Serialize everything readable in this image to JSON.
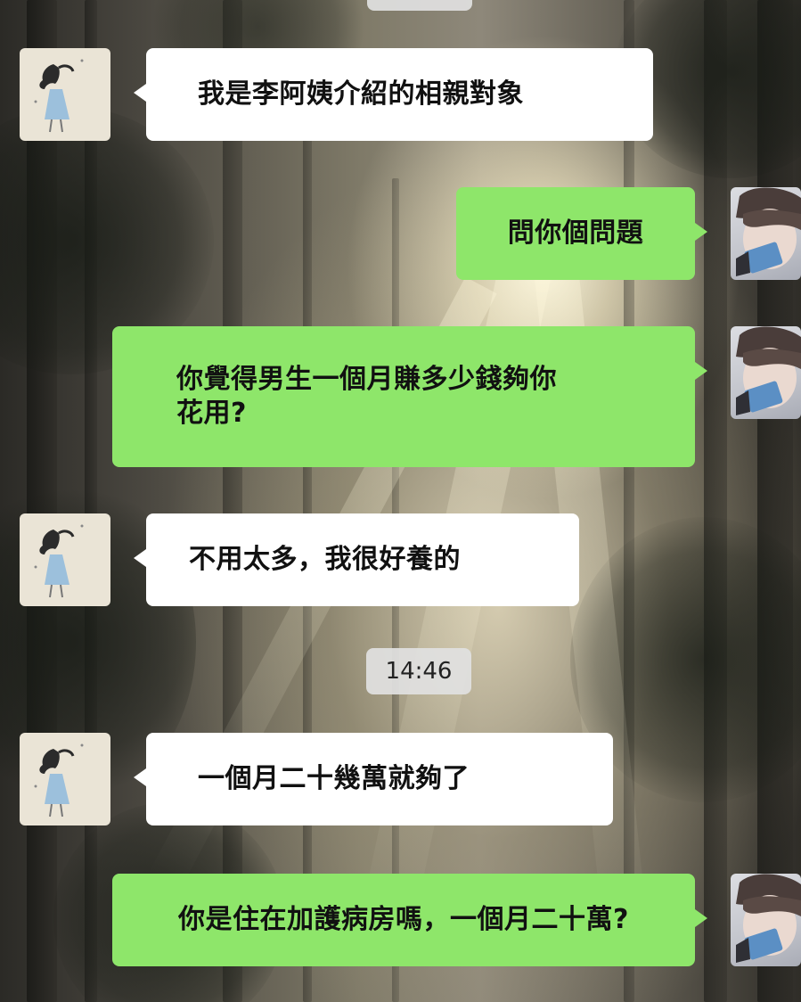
{
  "chat": {
    "messages": [
      {
        "side": "left",
        "sender": "girl",
        "text": "我是李阿姨介紹的相親對象"
      },
      {
        "side": "right",
        "sender": "boy",
        "text": "問你個問題"
      },
      {
        "side": "right",
        "sender": "boy",
        "line1": "你覺得男生一個月賺多少錢夠你",
        "line2": "花用?"
      },
      {
        "side": "left",
        "sender": "girl",
        "text": "不用太多，我很好養的"
      },
      {
        "side": "left",
        "sender": "girl",
        "text": "一個月二十幾萬就夠了"
      },
      {
        "side": "right",
        "sender": "boy",
        "text": "你是住在加護病房嗎，一個月二十萬?"
      }
    ],
    "timestamp": "14:46"
  },
  "colors": {
    "incoming_bubble": "#ffffff",
    "outgoing_bubble": "#8ee66a",
    "timestamp_bg": "#e1e1e1"
  },
  "icons": {
    "girl_avatar": "girl-avatar-icon",
    "boy_avatar": "boy-avatar-icon"
  }
}
